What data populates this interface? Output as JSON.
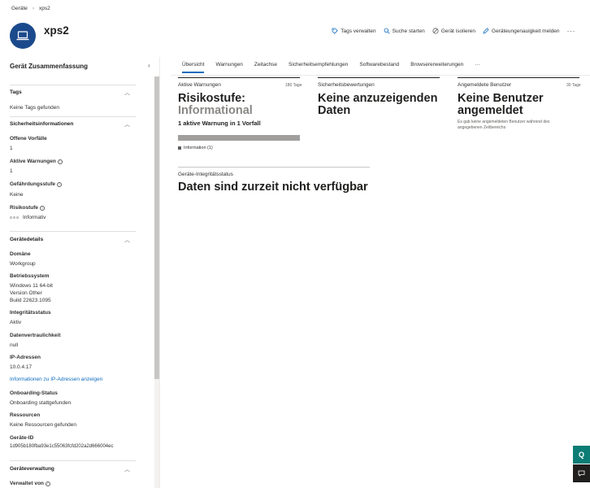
{
  "breadcrumb": {
    "root": "Geräte",
    "current": "xps2"
  },
  "device": {
    "name": "xps2"
  },
  "actions": {
    "manage_tags": "Tags verwalten",
    "search": "Suche starten",
    "isolate": "Gerät isolieren",
    "report": "Geräteungenauigkeit melden",
    "more": "···"
  },
  "left_panel": {
    "title": "Gerät Zusammenfassung",
    "tags": {
      "title": "Tags",
      "empty": "Keine Tags gefunden"
    },
    "security": {
      "title": "Sicherheitsinformationen",
      "open_incidents_label": "Offene Vorfälle",
      "open_incidents_value": "1",
      "active_alerts_label": "Aktive Warnungen",
      "active_alerts_value": "1",
      "exposure_label": "Gefährdungsstufe",
      "exposure_value": "Keine",
      "risk_label": "Risikostufe",
      "risk_value": "Informativ"
    },
    "details": {
      "title": "Gerätedetails",
      "domain_label": "Domäne",
      "domain_value": "Workgroup",
      "os_label": "Betriebssystem",
      "os_line1": "Windows 11 64-bit",
      "os_line2": "Version Other",
      "os_line3": "Build 22623.1095",
      "health_label": "Integritätsstatus",
      "health_value": "Aktiv",
      "confidentiality_label": "Datenvertraulichkeit",
      "confidentiality_value": "null",
      "ip_label": "IP-Adressen",
      "ip_value": "10.0.4.17",
      "ip_link": "Informationen zu IP-Adressen anzeigen",
      "onboarding_label": "Onboarding-Status",
      "onboarding_value": "Onboarding stattgefunden",
      "resources_label": "Ressourcen",
      "resources_value": "Keine Ressourcen gefunden",
      "device_id_label": "Geräte-ID",
      "device_id_value": "1d905b180fba93e1c55063fcfd202a2d666004ec"
    },
    "management": {
      "title": "Geräteverwaltung",
      "managed_by_label": "Verwaltet von"
    }
  },
  "tabs": [
    "Übersicht",
    "Warnungen",
    "Zeitachse",
    "Sicherheitsempfehlungen",
    "Softwarebestand",
    "Browsererweiterungen",
    "···"
  ],
  "cards": {
    "alerts": {
      "title": "Aktive Warnungen",
      "tag": "180 Tage",
      "risk_line1": "Risikostufe:",
      "risk_line2": "Informational",
      "summary": "1 aktive Warnung in 1 Vorfall",
      "legend": "Information (1)",
      "info_fraction": 1.0
    },
    "assessments": {
      "title": "Sicherheitsbewertungen",
      "line1": "Keine anzuzeigenden",
      "line2": "Daten"
    },
    "users": {
      "title": "Angemeldete Benutzer",
      "tag": "30 Tage",
      "line1": "Keine Benutzer",
      "line2": "angemeldet",
      "desc1": "Es gab keine angemeldeten Benutzer während des",
      "desc2": "angegebenen Zeitbereichs"
    },
    "health": {
      "title": "Geräte-Integritätsstatus",
      "message": "Daten sind zurzeit nicht verfügbar"
    }
  },
  "floating": {
    "q_label": "Q"
  },
  "colors": {
    "avatar": "#1b4a8c",
    "accent": "#0f6cbd",
    "floating": "#0b7d74"
  }
}
